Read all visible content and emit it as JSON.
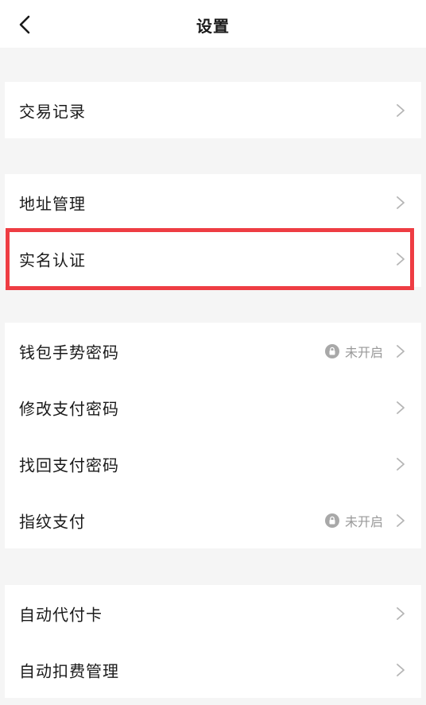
{
  "header": {
    "title": "设置"
  },
  "groups": [
    {
      "items": [
        {
          "label": "交易记录"
        }
      ]
    },
    {
      "items": [
        {
          "label": "地址管理"
        },
        {
          "label": "实名认证"
        }
      ]
    },
    {
      "items": [
        {
          "label": "钱包手势密码",
          "status": "未开启"
        },
        {
          "label": "修改支付密码"
        },
        {
          "label": "找回支付密码"
        },
        {
          "label": "指纹支付",
          "status": "未开启"
        }
      ]
    },
    {
      "items": [
        {
          "label": "自动代付卡"
        },
        {
          "label": "自动扣费管理"
        }
      ]
    }
  ],
  "colors": {
    "highlight": "#ee3d43",
    "background": "#f5f5f5",
    "secondary_text": "#999999"
  },
  "icons": {
    "back": "chevron-left-icon",
    "row_arrow": "chevron-right-icon",
    "status": "lock-icon"
  }
}
